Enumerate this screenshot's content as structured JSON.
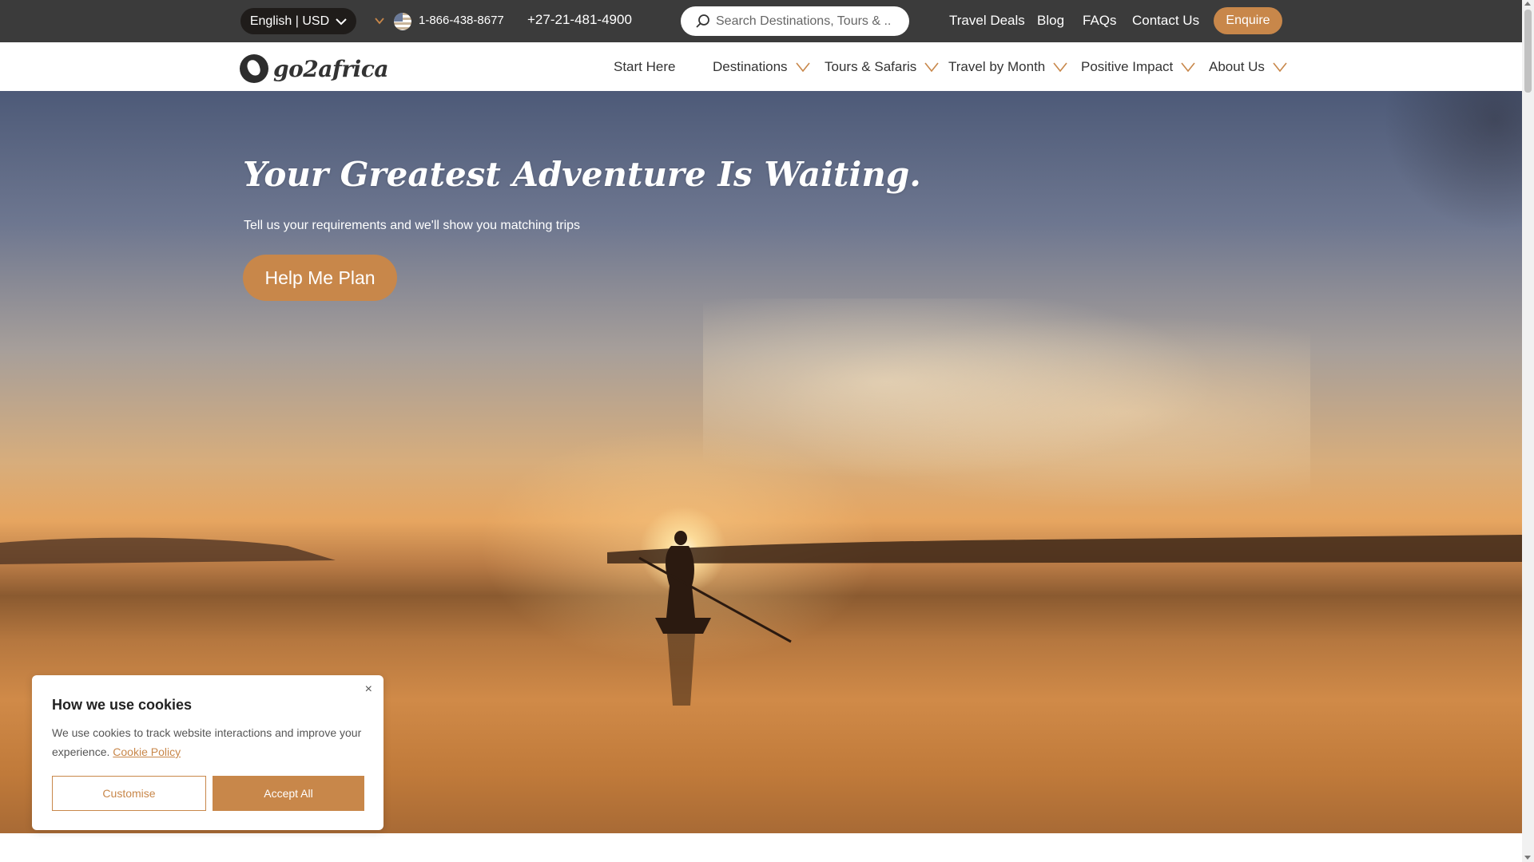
{
  "topbar": {
    "language_label": "English | USD",
    "phone_us": "1-866-438-8677",
    "phone_za": "+27-21-481-4900",
    "search_placeholder": "Search Destinations, Tours & ...",
    "links": [
      "Travel Deals",
      "Blog",
      "FAQs",
      "Contact Us"
    ],
    "enquire_label": "Enquire"
  },
  "nav": {
    "logo_text": "go2africa",
    "items": [
      {
        "label": "Start Here",
        "dropdown": false
      },
      {
        "label": "Destinations",
        "dropdown": true
      },
      {
        "label": "Tours & Safaris",
        "dropdown": true
      },
      {
        "label": "Travel by Month",
        "dropdown": true
      },
      {
        "label": "Positive Impact",
        "dropdown": true
      },
      {
        "label": "About Us",
        "dropdown": true
      }
    ]
  },
  "hero": {
    "title": "Your Greatest Adventure Is Waiting.",
    "subtitle": "Tell us your requirements and we'll show you matching trips",
    "cta_label": "Help Me Plan"
  },
  "cookie": {
    "title": "How we use cookies",
    "body": "We use cookies to track website interactions and improve your experience.",
    "link_label": "Cookie Policy",
    "customise_label": "Customise",
    "accept_label": "Accept All",
    "close_glyph": "×"
  },
  "colors": {
    "accent": "#c8874a",
    "topbar_bg": "#3b3b3b",
    "language_bg": "#1f1c1a"
  }
}
